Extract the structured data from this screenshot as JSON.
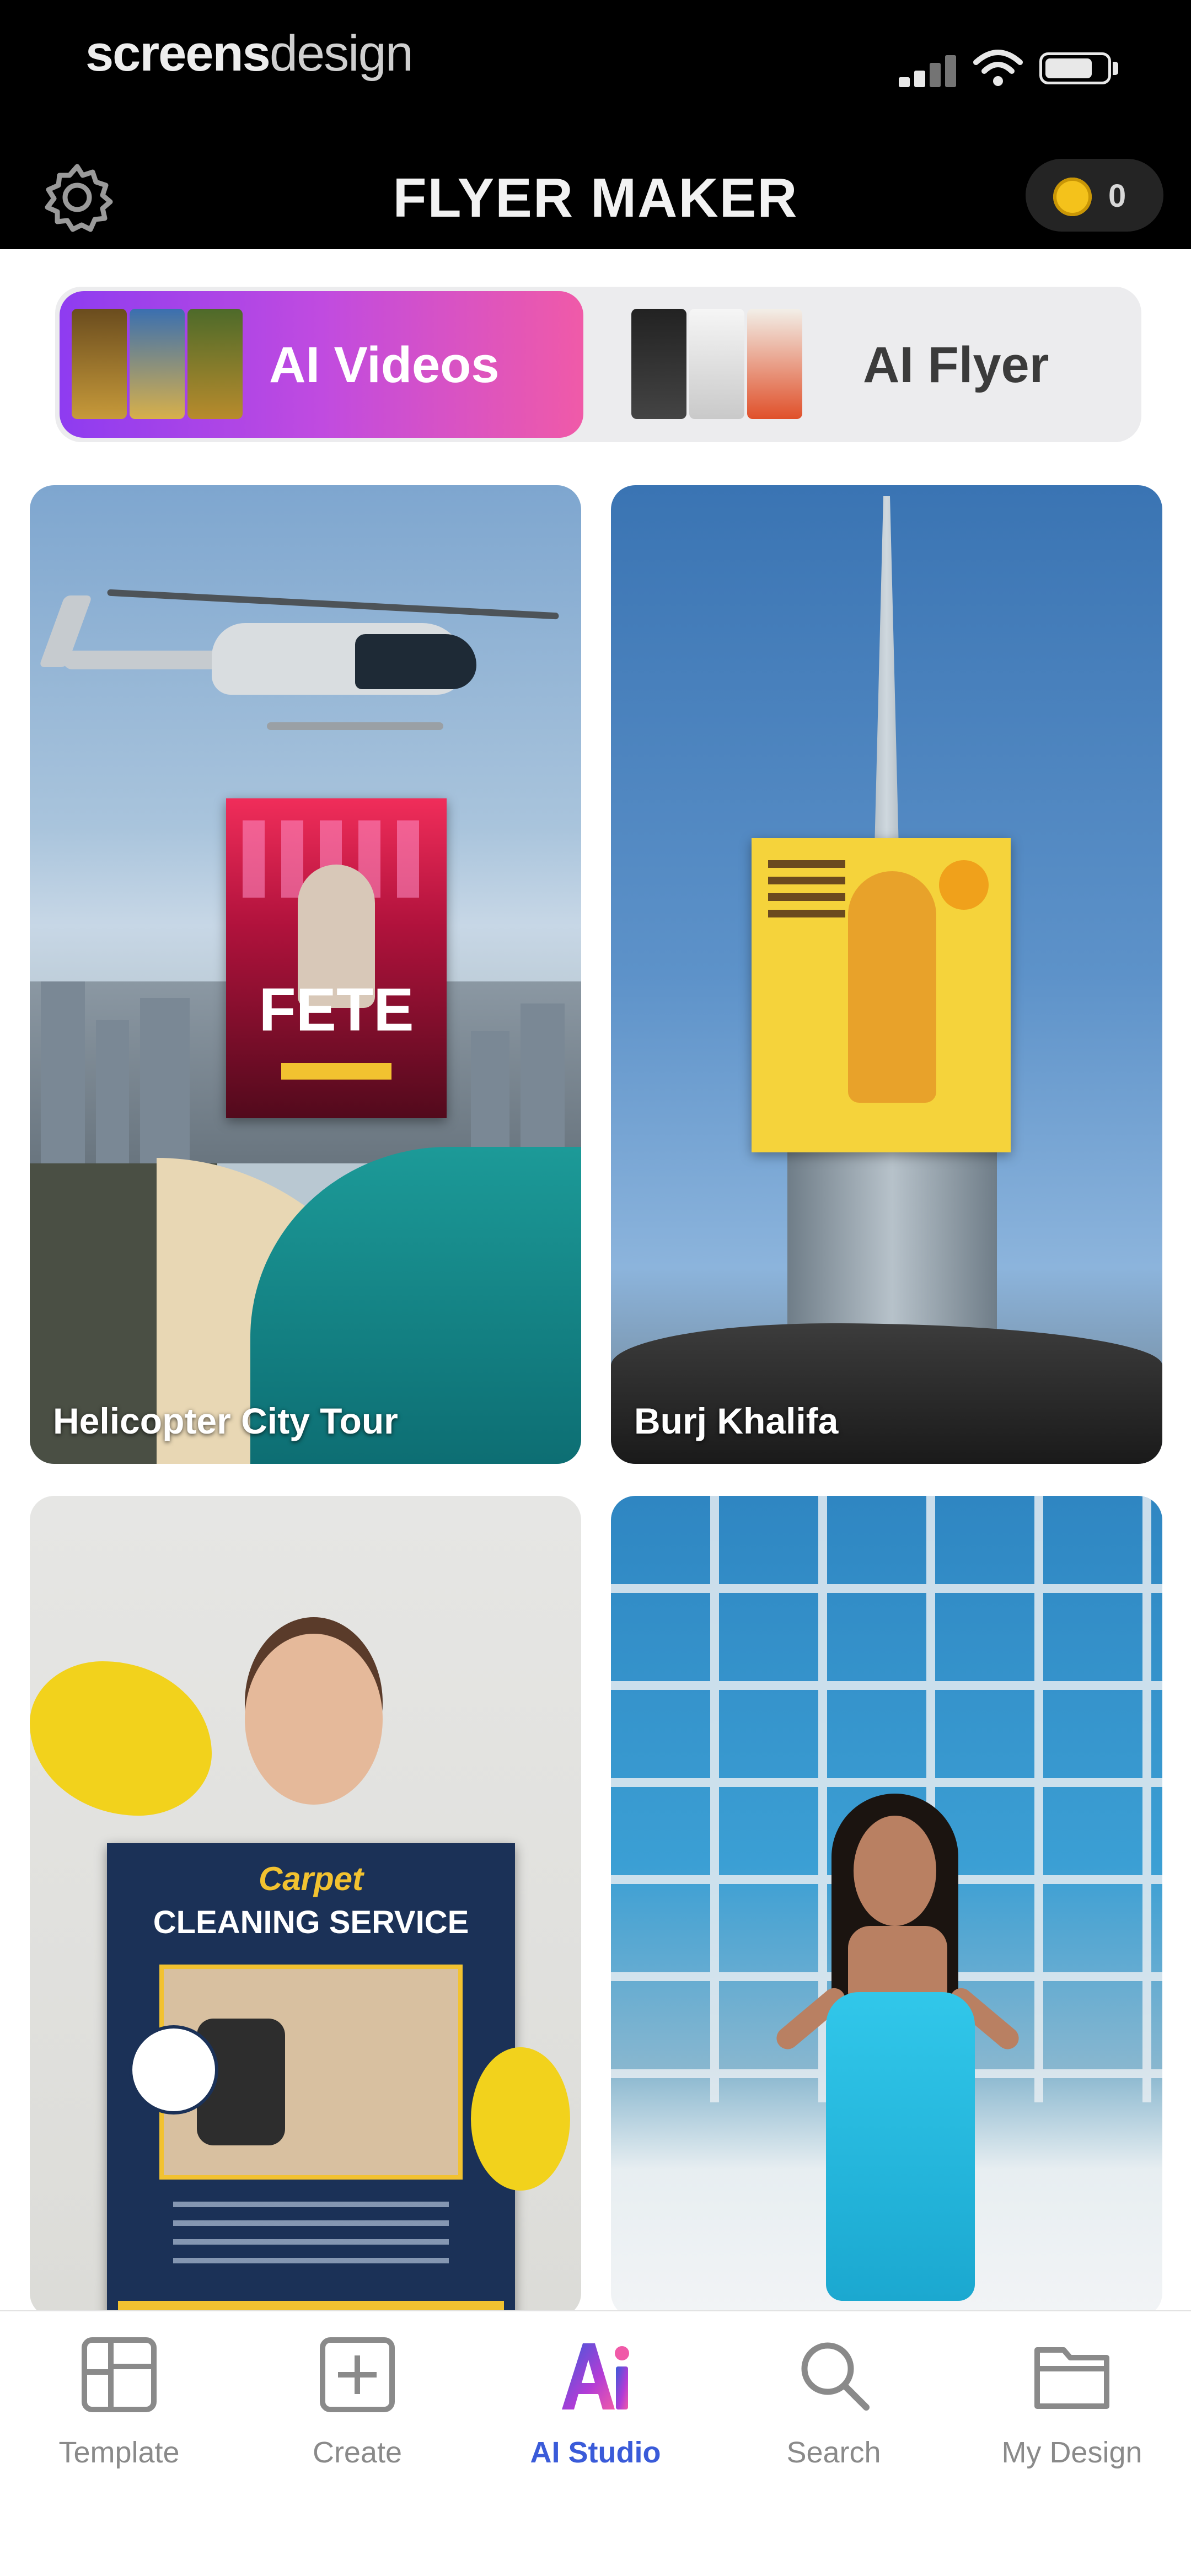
{
  "status_bar": {
    "brand_bold": "screens",
    "brand_light": "design"
  },
  "header": {
    "title": "FLYER MAKER",
    "coin_count": "0",
    "coin_color": "#f4c21b",
    "settings_icon": "gear-icon"
  },
  "tabs": {
    "ai_videos": "AI Videos",
    "ai_flyer": "AI Flyer",
    "active": "ai_videos",
    "active_gradient": [
      "#8e3cf0",
      "#f05aa8"
    ]
  },
  "cards": [
    {
      "caption": "Helicopter City Tour",
      "flyer_text": "FETE"
    },
    {
      "caption": "Burj Khalifa",
      "flyer_text": ""
    },
    {
      "caption": "",
      "flyer_script": "Carpet",
      "flyer_text": "CLEANING SERVICE"
    },
    {
      "caption": ""
    }
  ],
  "bottom_nav": {
    "items": [
      {
        "label": "Template",
        "icon": "template-grid-icon"
      },
      {
        "label": "Create",
        "icon": "plus-square-icon"
      },
      {
        "label": "AI Studio",
        "icon": "ai-studio-icon"
      },
      {
        "label": "Search",
        "icon": "search-icon"
      },
      {
        "label": "My Design",
        "icon": "folder-icon"
      }
    ],
    "active": "AI Studio",
    "active_color": "#3a5bd9"
  }
}
